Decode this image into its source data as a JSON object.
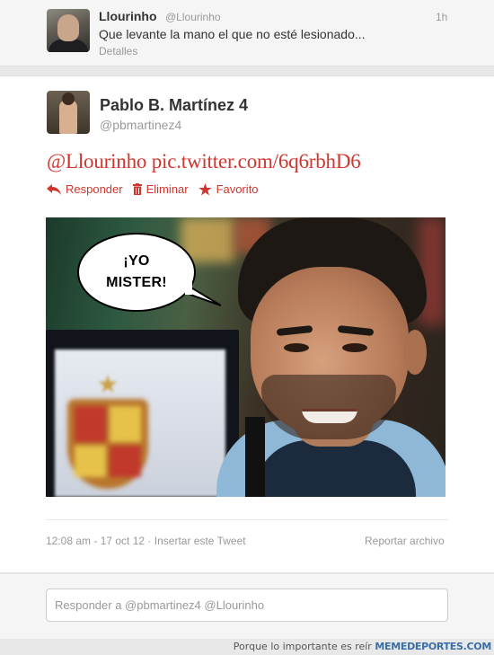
{
  "previous_tweet": {
    "name": "Llourinho",
    "handle": "@Llourinho",
    "time": "1h",
    "text": "Que levante la mano el que no esté lesionado...",
    "details_link": "Detalles"
  },
  "tweet": {
    "author_name": "Pablo B. Martínez 4",
    "author_handle": "@pbmartinez4",
    "text": "@Llourinho pic.twitter.com/6q6rbhD6",
    "actions": {
      "reply": "Responder",
      "delete": "Eliminar",
      "favorite": "Favorito"
    },
    "image": {
      "speech_line1": "¡YO",
      "speech_line2": "MISTER!"
    },
    "timestamp": "12:08 am - 17 oct 12",
    "embed": "Insertar este Tweet",
    "separator": "·",
    "report": "Reportar archivo"
  },
  "reply_box": {
    "placeholder": "Responder a @pbmartinez4 @Llourinho"
  },
  "watermark": {
    "tagline": "Porque lo importante es reír",
    "brand": "MEMEDEPORTES.COM"
  },
  "colors": {
    "accent": "#d0362e",
    "muted": "#999999",
    "watermark": "#3a6ea5"
  }
}
